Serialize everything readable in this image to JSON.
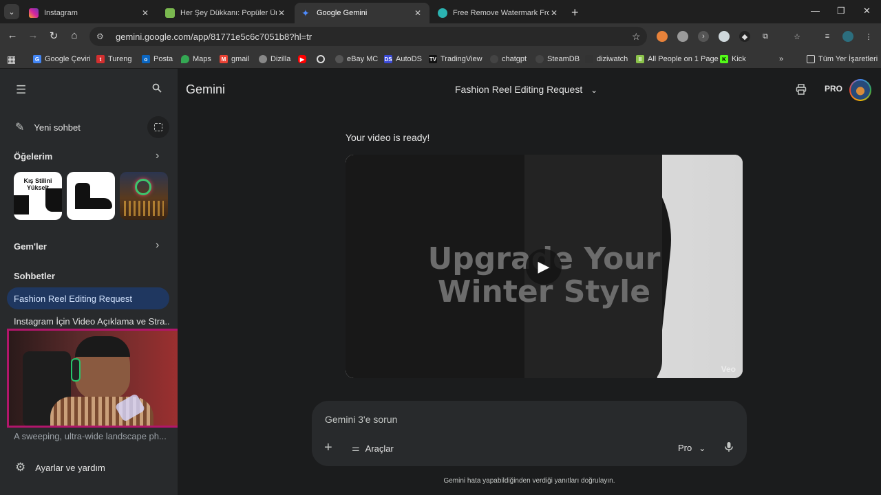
{
  "browser": {
    "tabs": [
      {
        "title": "Instagram",
        "icon": "instagram-icon",
        "color": "#d6249f"
      },
      {
        "title": "Her Şey Dükkanı: Popüler Ürünl",
        "icon": "shop-icon",
        "color": "#7ab84f"
      },
      {
        "title": "Google Gemini",
        "icon": "gemini-icon",
        "color": "#4e8cff"
      },
      {
        "title": "Free Remove Watermark From V",
        "icon": "watermark-icon",
        "color": "#2bb3b1"
      }
    ],
    "url": "gemini.google.com/app/81771e5c6c7051b8?hl=tr",
    "bookmarks": [
      {
        "label": "Google Çeviri",
        "icon": "translate-icon",
        "color": "#4285f4"
      },
      {
        "label": "Tureng",
        "icon": "tureng-icon",
        "color": "#d32f2f"
      },
      {
        "label": "Posta",
        "icon": "mail-icon",
        "color": "#0a66c2"
      },
      {
        "label": "Maps",
        "icon": "maps-icon",
        "color": "#34a853"
      },
      {
        "label": "gmail",
        "icon": "gmail-icon",
        "color": "#ea4335"
      },
      {
        "label": "Dizilla",
        "icon": "dizilla-icon",
        "color": "#888888"
      },
      {
        "label": "",
        "icon": "youtube-icon",
        "color": "#ff0000"
      },
      {
        "label": "",
        "icon": "circle-icon",
        "color": "#dddddd"
      },
      {
        "label": "eBay MC",
        "icon": "ebay-icon",
        "color": "#555555"
      },
      {
        "label": "AutoDS",
        "icon": "autods-icon",
        "color": "#3a4ad8"
      },
      {
        "label": "TradingView",
        "icon": "tradingview-icon",
        "color": "#111111"
      },
      {
        "label": "chatgpt",
        "icon": "chatgpt-icon",
        "color": "#444444"
      },
      {
        "label": "SteamDB",
        "icon": "steamdb-icon",
        "color": "#444444"
      },
      {
        "label": "diziwatch",
        "icon": "diziwatch-icon",
        "color": "#333333"
      },
      {
        "label": "All People on 1 Page",
        "icon": "people-icon",
        "color": "#8bc34a"
      },
      {
        "label": "Kick",
        "icon": "kick-icon",
        "color": "#53fc18"
      }
    ],
    "all_bookmarks": "Tüm Yer İşaretleri"
  },
  "sidebar": {
    "new_chat": "Yeni sohbet",
    "items_header": "Öğelerim",
    "thumb1_text": "Kış Stilini Yükselt",
    "gems_header": "Gem'ler",
    "chats_header": "Sohbetler",
    "chats": [
      "Fashion Reel Editing Request",
      "Instagram İçin Video Açıklama ve Stra...",
      "A sweeping, ultra-wide landscape ph..."
    ],
    "settings": "Ayarlar ve yardım"
  },
  "main": {
    "brand": "Gemini",
    "conversation_title": "Fashion Reel Editing Request",
    "pro_badge": "PRO",
    "ready_text": "Your video is ready!",
    "video_overlay_line1": "Upgrade Your",
    "video_overlay_line2": "Winter Style",
    "video_watermark": "Veo",
    "composer": {
      "placeholder": "Gemini 3'e sorun",
      "tools_label": "Araçlar",
      "model_label": "Pro"
    },
    "disclaimer": "Gemini hata yapabildiğinden verdiği yanıtları doğrulayın."
  }
}
